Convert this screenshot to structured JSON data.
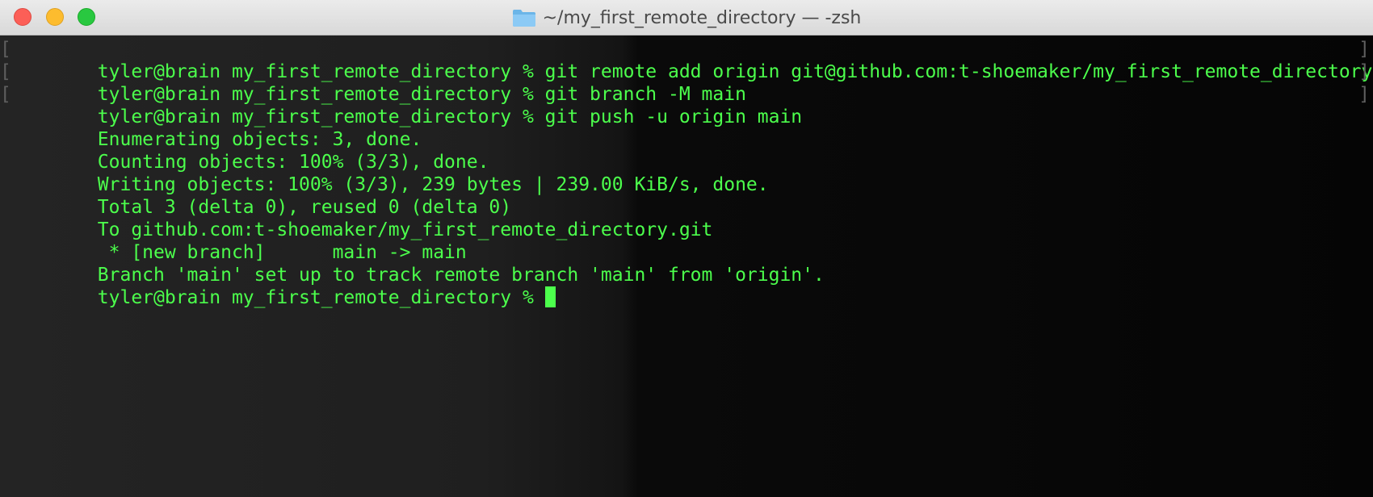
{
  "window": {
    "title": "~/my_first_remote_directory — -zsh",
    "folder_icon": "folder-icon",
    "controls": [
      "close",
      "minimize",
      "maximize"
    ]
  },
  "colors": {
    "text": "#4cff4c",
    "background": "#0d0d0d",
    "bracket": "#5f5f5f"
  },
  "terminal": {
    "lines": [
      {
        "text": "tyler@brain my_first_remote_directory % git remote add origin git@github.com:t-shoemaker/my_first_remote_directory.git",
        "marked": true
      },
      {
        "text": "tyler@brain my_first_remote_directory % git branch -M main",
        "marked": true
      },
      {
        "text": "tyler@brain my_first_remote_directory % git push -u origin main",
        "marked": true
      },
      {
        "text": "Enumerating objects: 3, done.",
        "marked": false
      },
      {
        "text": "Counting objects: 100% (3/3), done.",
        "marked": false
      },
      {
        "text": "Writing objects: 100% (3/3), 239 bytes | 239.00 KiB/s, done.",
        "marked": false
      },
      {
        "text": "Total 3 (delta 0), reused 0 (delta 0)",
        "marked": false
      },
      {
        "text": "To github.com:t-shoemaker/my_first_remote_directory.git",
        "marked": false
      },
      {
        "text": " * [new branch]      main -> main",
        "marked": false
      },
      {
        "text": "Branch 'main' set up to track remote branch 'main' from 'origin'.",
        "marked": false
      }
    ],
    "prompt": "tyler@brain my_first_remote_directory % "
  }
}
